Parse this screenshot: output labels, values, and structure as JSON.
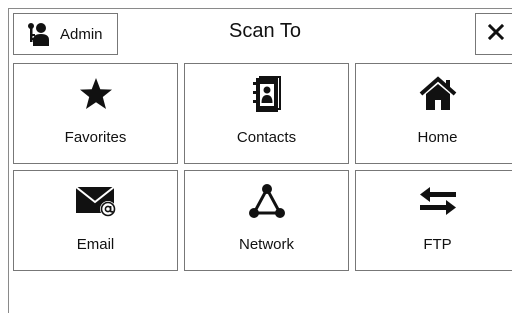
{
  "header": {
    "admin_label": "Admin",
    "admin_icon": "admin-key-user-icon",
    "title": "Scan To",
    "close_icon": "close-icon"
  },
  "tiles": [
    {
      "label": "Favorites",
      "icon": "star-icon"
    },
    {
      "label": "Contacts",
      "icon": "address-book-icon"
    },
    {
      "label": "Home",
      "icon": "home-icon"
    },
    {
      "label": "Email",
      "icon": "envelope-at-icon"
    },
    {
      "label": "Network",
      "icon": "network-nodes-icon"
    },
    {
      "label": "FTP",
      "icon": "transfer-arrows-icon"
    }
  ],
  "colors": {
    "border": "#777777",
    "icon": "#111111",
    "background": "#ffffff"
  }
}
